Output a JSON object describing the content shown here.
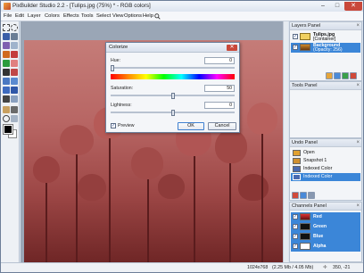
{
  "window": {
    "title": "PixBuilder Studio 2.2 - [Tulips.jpg (75%) * - RGB colors]",
    "minimize": "–",
    "maximize": "□",
    "close": "✕"
  },
  "menu": [
    "File",
    "Edit",
    "Layer",
    "Colors",
    "Effects",
    "Tools",
    "Select",
    "View",
    "Options",
    "Help"
  ],
  "layers_panel": {
    "title": "Layers Panel",
    "close": "×",
    "layers": [
      {
        "name": "Tulips.jpg",
        "sub": "[Container]",
        "selected": false
      },
      {
        "name": "Background",
        "sub": "(Opacity: 256)",
        "selected": true
      }
    ]
  },
  "tools_panel": {
    "title": "Tools Panel",
    "close": "×"
  },
  "undo_panel": {
    "title": "Undo Panel",
    "close": "×",
    "items": [
      {
        "label": "Open",
        "selected": false
      },
      {
        "label": "Snapshot 1",
        "selected": false
      },
      {
        "label": "Indexed Color",
        "selected": false
      },
      {
        "label": "Indexed Color",
        "selected": true
      }
    ]
  },
  "channels_panel": {
    "title": "Channels Panel",
    "close": "×",
    "channels": [
      {
        "label": "Red",
        "selected": true
      },
      {
        "label": "Green",
        "selected": true
      },
      {
        "label": "Blue",
        "selected": true
      },
      {
        "label": "Alpha",
        "selected": true
      }
    ]
  },
  "dialog": {
    "title": "Colorize",
    "close": "✕",
    "hue_label": "Hue:",
    "hue_value": "0",
    "saturation_label": "Saturation:",
    "saturation_value": "50",
    "lightness_label": "Lightness:",
    "lightness_value": "0",
    "preview_label": "Preview",
    "preview_checked": true,
    "ok_label": "OK",
    "cancel_label": "Cancel",
    "hue_level": 0.0,
    "saturation_level": 0.5,
    "lightness_level": 0.5
  },
  "status": {
    "dimensions": "1024x768",
    "memory": "(2.25 Mb / 4.05 Mb)",
    "coords": "350, -21"
  },
  "colors": {
    "accent": "#3b86d8",
    "canvas_tint": "#b76563",
    "close_red": "#c9483a"
  }
}
